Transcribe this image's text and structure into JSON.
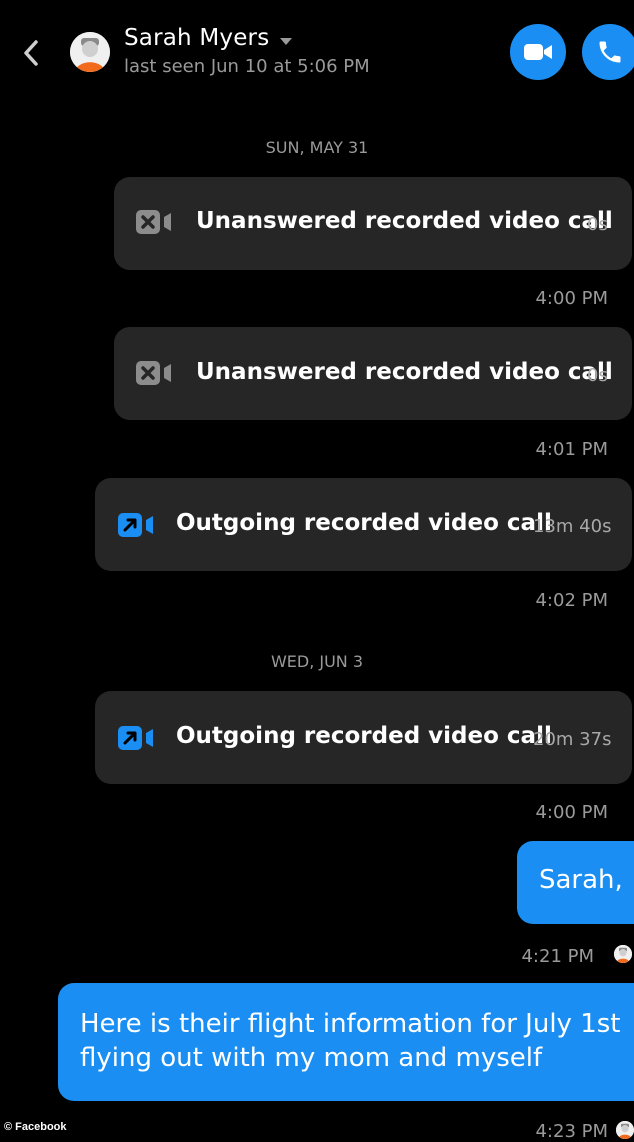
{
  "header": {
    "contact_name": "Sarah Myers",
    "last_seen": "last seen Jun 10 at 5:06 PM",
    "back_icon": "chevron-left-icon",
    "video_icon": "video-camera-icon",
    "phone_icon": "phone-icon",
    "accent_color": "#1a8ef2"
  },
  "conversation": {
    "date_separators": [
      "SUN, MAY 31",
      "WED, JUN 3"
    ],
    "calls": [
      {
        "type": "unanswered",
        "label": "Unanswered recorded video call",
        "duration": "0s",
        "time": "4:00 PM",
        "icon": "missed-video-icon"
      },
      {
        "type": "unanswered",
        "label": "Unanswered recorded video call",
        "duration": "0s",
        "time": "4:01 PM",
        "icon": "missed-video-icon"
      },
      {
        "type": "outgoing",
        "label": "Outgoing recorded video call",
        "duration": "13m 40s",
        "time": "4:02 PM",
        "icon": "outgoing-video-icon"
      },
      {
        "type": "outgoing",
        "label": "Outgoing recorded video call",
        "duration": "20m 37s",
        "time": "4:00 PM",
        "icon": "outgoing-video-icon"
      }
    ],
    "messages": [
      {
        "text": "Sarah,",
        "time": "4:21 PM"
      },
      {
        "text": "Here is their flight information for July 1st flying out with my mom and myself",
        "time": "4:23 PM"
      }
    ]
  },
  "watermark": "© Facebook"
}
